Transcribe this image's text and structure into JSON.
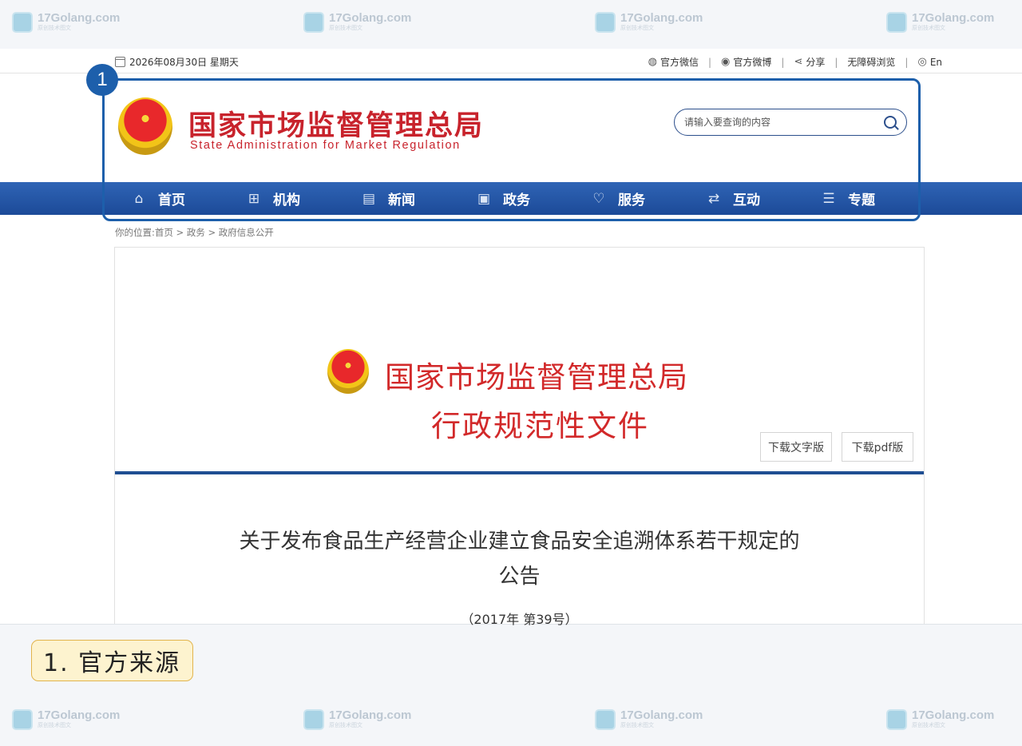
{
  "watermark": {
    "domain": "17Golang.com",
    "tagline": "原创技术图文",
    "logo": "ROI"
  },
  "topbar": {
    "date": "2026年08月30日 星期天",
    "links": [
      {
        "label": "官方微信",
        "icon": "wechat-icon",
        "glyph": "◍"
      },
      {
        "label": "官方微博",
        "icon": "weibo-icon",
        "glyph": "◉"
      },
      {
        "label": "分享",
        "icon": "share-icon",
        "glyph": "⋖"
      },
      {
        "label": "无障碍浏览",
        "icon": "",
        "glyph": ""
      },
      {
        "label": "En",
        "icon": "globe-icon",
        "glyph": "◎"
      }
    ]
  },
  "header": {
    "title_cn": "国家市场监督管理总局",
    "title_en": "State Administration for Market Regulation",
    "search_placeholder": "请输入要查询的内容"
  },
  "nav": [
    {
      "label": "首页",
      "icon": "home-icon",
      "glyph": "⌂"
    },
    {
      "label": "机构",
      "icon": "org-chart-icon",
      "glyph": "⊞"
    },
    {
      "label": "新闻",
      "icon": "newspaper-icon",
      "glyph": "▤"
    },
    {
      "label": "政务",
      "icon": "book-icon",
      "glyph": "▣"
    },
    {
      "label": "服务",
      "icon": "heart-icon",
      "glyph": "♡"
    },
    {
      "label": "互动",
      "icon": "exchange-icon",
      "glyph": "⇄"
    },
    {
      "label": "专题",
      "icon": "list-icon",
      "glyph": "☰"
    }
  ],
  "breadcrumb": "你的位置:首页 > 政务 > 政府信息公开",
  "document": {
    "org": "国家市场监督管理总局",
    "type": "行政规范性文件",
    "download_text": "下载文字版",
    "download_pdf": "下载pdf版",
    "title_line1": "关于发布食品生产经营企业建立食品安全追溯体系若干规定的",
    "title_line2": "公告",
    "number": "（2017年 第39号）"
  },
  "annotation": {
    "badge": "1",
    "caption": "1. 官方来源"
  },
  "colors": {
    "brand_red": "#c8232c",
    "nav_blue": "#1c4a98",
    "annotation_blue": "#1d5fab"
  }
}
